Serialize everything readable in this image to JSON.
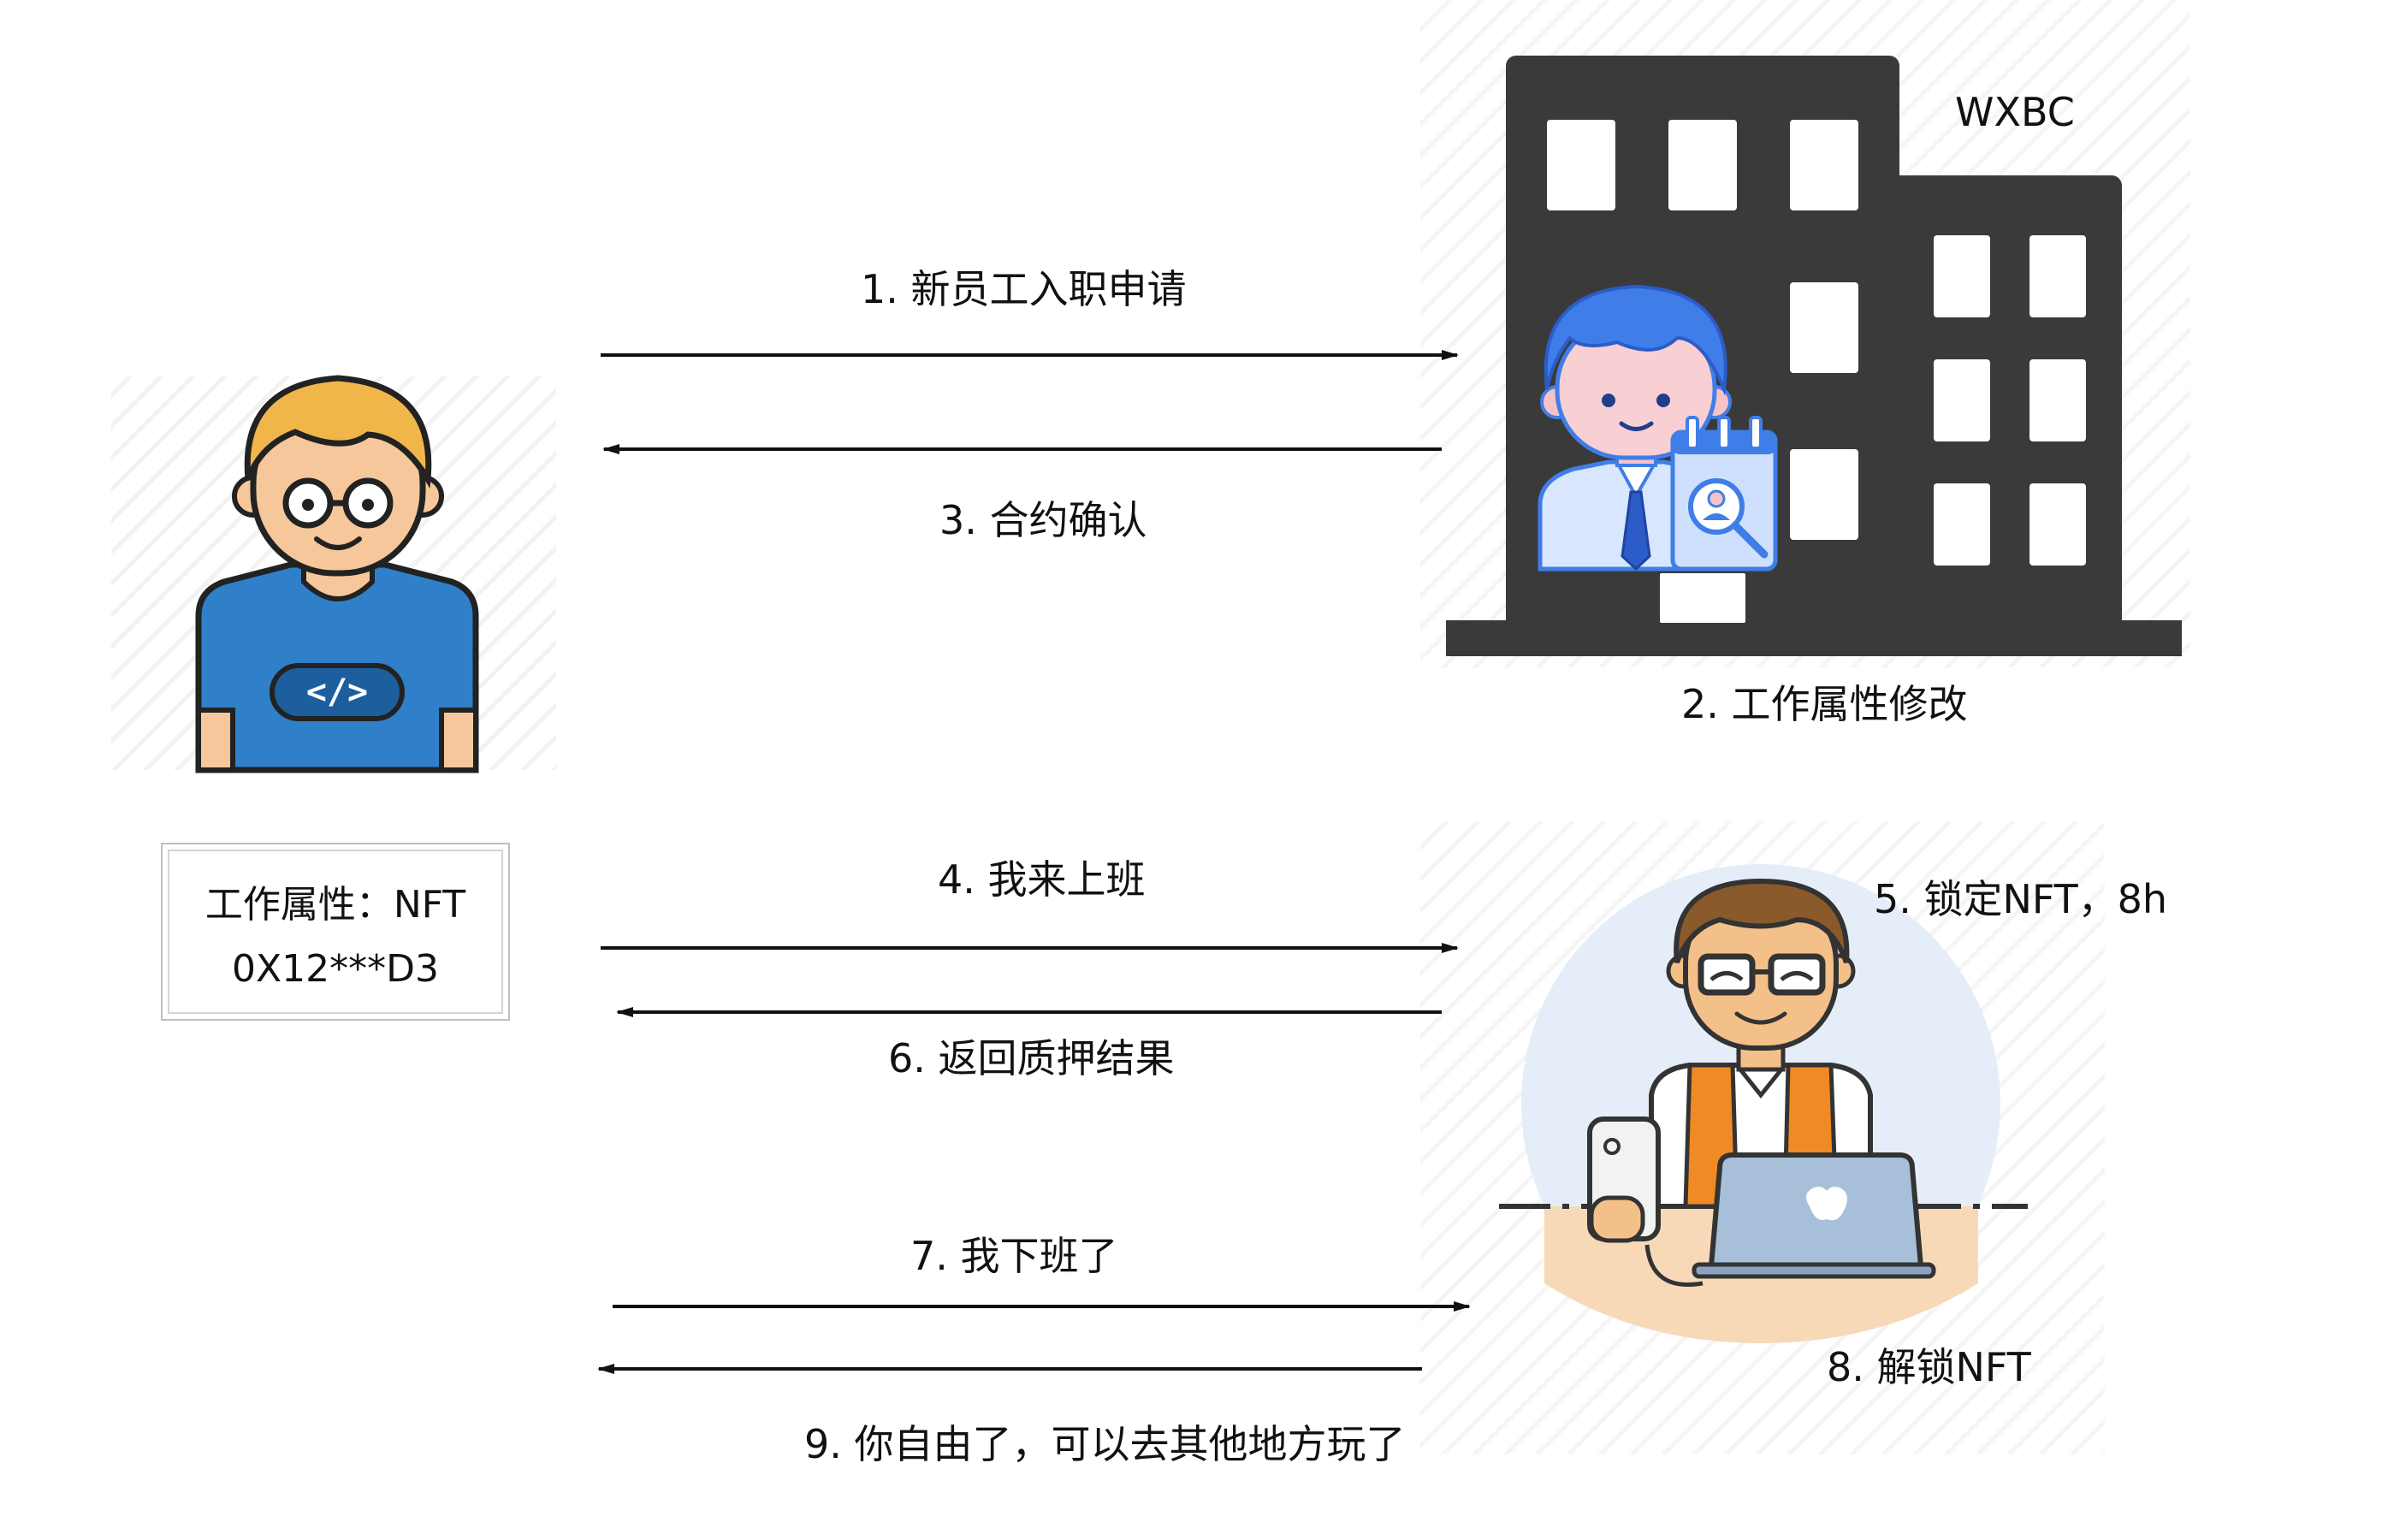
{
  "labels": {
    "company": "WXBC",
    "step1": "1. 新员工入职申请",
    "step2": "2. 工作属性修改",
    "step3": "3. 合约确认",
    "step4": "4. 我来上班",
    "step5": "5. 锁定NFT，8h",
    "step6": "6. 返回质押结果",
    "step7": "7. 我下班了",
    "step8": "8. 解锁NFT",
    "step9": "9. 你自由了，可以去其他地方玩了"
  },
  "nft_box": {
    "line1": "工作属性：NFT",
    "line2": "0X12***D3"
  },
  "icons": {
    "developer": "developer-avatar-icon",
    "building": "office-building-icon",
    "hr": "hr-recruiter-icon",
    "worker": "worker-at-laptop-icon"
  },
  "colors": {
    "building": "#3a3a3a",
    "shirt": "#2f7fc9",
    "hr_blue": "#3f7ee8",
    "vest": "#f08a24",
    "arrow": "#111111"
  }
}
